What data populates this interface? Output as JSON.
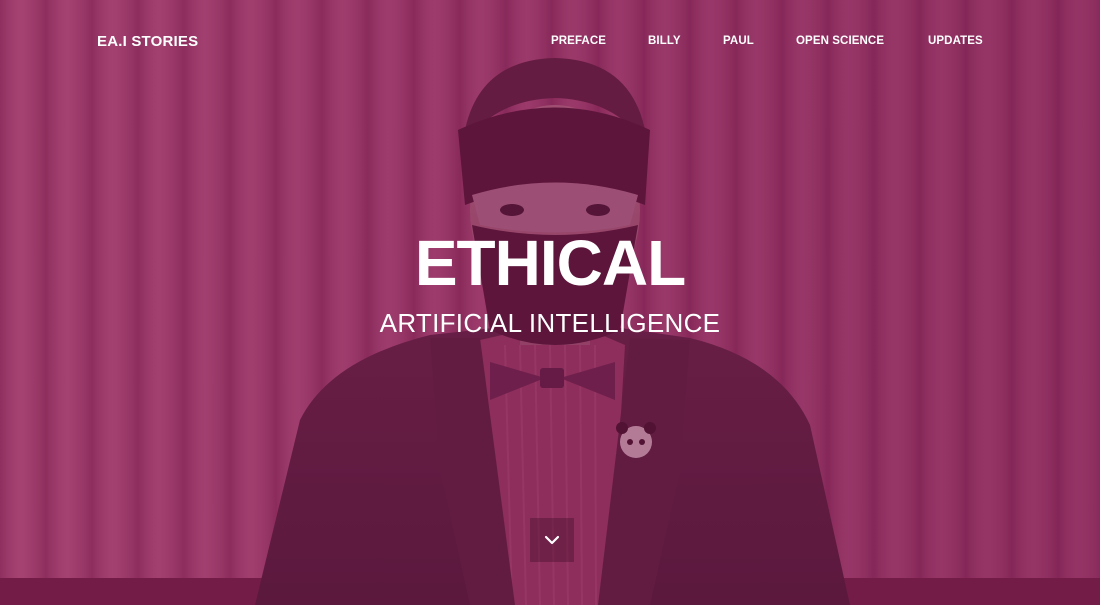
{
  "header": {
    "brand": "EA.I STORIES"
  },
  "nav": {
    "items": [
      {
        "label": "PREFACE"
      },
      {
        "label": "BILLY"
      },
      {
        "label": "PAUL"
      },
      {
        "label": "OPEN SCIENCE"
      },
      {
        "label": "UPDATES"
      }
    ]
  },
  "hero": {
    "title": "ETHICAL",
    "subtitle": "ARTIFICIAL INTELLIGENCE",
    "scroll_icon": "chevron-down-icon",
    "overlay_color": "#8a2a5c"
  }
}
